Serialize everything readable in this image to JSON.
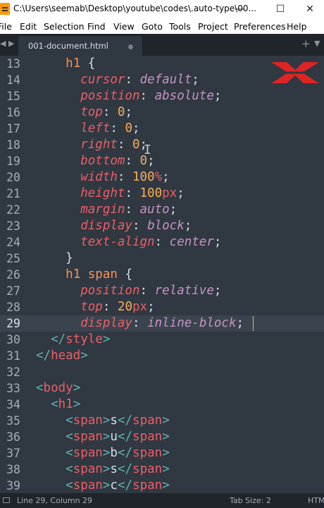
{
  "window": {
    "title": "C:\\Users\\seemab\\Desktop\\youtube\\codes\\.auto-type\\00...",
    "minimize": "—",
    "maximize": "☐",
    "close": "✕"
  },
  "menu": [
    "File",
    "Edit",
    "Selection",
    "Find",
    "View",
    "Goto",
    "Tools",
    "Project",
    "Preferences",
    "Help"
  ],
  "tabs": {
    "left_arrow": "◀",
    "right_arrow": "▶",
    "active_label": "001-document.html",
    "modified": true,
    "new_tab": "+",
    "dropdown": "▼"
  },
  "editor": {
    "first_line_number": 13,
    "active_line": 29,
    "line_numbers": [
      "13",
      "14",
      "15",
      "16",
      "17",
      "18",
      "19",
      "20",
      "21",
      "22",
      "23",
      "24",
      "25",
      "26",
      "27",
      "28",
      "29",
      "30",
      "31",
      "32",
      "33",
      "34",
      "35",
      "36",
      "37",
      "38",
      "39"
    ],
    "lines": [
      [
        [
          "    ",
          "txt"
        ],
        [
          "h1",
          "sel"
        ],
        [
          " {",
          "punc"
        ]
      ],
      [
        [
          "      ",
          "txt"
        ],
        [
          "cursor",
          "prop"
        ],
        [
          ": ",
          "punc"
        ],
        [
          "default",
          "val"
        ],
        [
          ";",
          "punc"
        ]
      ],
      [
        [
          "      ",
          "txt"
        ],
        [
          "position",
          "prop"
        ],
        [
          ": ",
          "punc"
        ],
        [
          "absolute",
          "val"
        ],
        [
          ";",
          "punc"
        ]
      ],
      [
        [
          "      ",
          "txt"
        ],
        [
          "top",
          "prop"
        ],
        [
          ": ",
          "punc"
        ],
        [
          "0",
          "num"
        ],
        [
          ";",
          "punc"
        ]
      ],
      [
        [
          "      ",
          "txt"
        ],
        [
          "left",
          "prop"
        ],
        [
          ": ",
          "punc"
        ],
        [
          "0",
          "num"
        ],
        [
          ";",
          "punc"
        ]
      ],
      [
        [
          "      ",
          "txt"
        ],
        [
          "right",
          "prop"
        ],
        [
          ": ",
          "punc"
        ],
        [
          "0",
          "num"
        ],
        [
          ";",
          "punc"
        ]
      ],
      [
        [
          "      ",
          "txt"
        ],
        [
          "bottom",
          "prop"
        ],
        [
          ": ",
          "punc"
        ],
        [
          "0",
          "num"
        ],
        [
          ";",
          "punc"
        ]
      ],
      [
        [
          "      ",
          "txt"
        ],
        [
          "width",
          "prop"
        ],
        [
          ": ",
          "punc"
        ],
        [
          "100",
          "num"
        ],
        [
          "%",
          "unit"
        ],
        [
          ";",
          "punc"
        ]
      ],
      [
        [
          "      ",
          "txt"
        ],
        [
          "height",
          "prop"
        ],
        [
          ": ",
          "punc"
        ],
        [
          "100",
          "num"
        ],
        [
          "px",
          "unit"
        ],
        [
          ";",
          "punc"
        ]
      ],
      [
        [
          "      ",
          "txt"
        ],
        [
          "margin",
          "prop"
        ],
        [
          ": ",
          "punc"
        ],
        [
          "auto",
          "val"
        ],
        [
          ";",
          "punc"
        ]
      ],
      [
        [
          "      ",
          "txt"
        ],
        [
          "display",
          "prop"
        ],
        [
          ": ",
          "punc"
        ],
        [
          "block",
          "val"
        ],
        [
          ";",
          "punc"
        ]
      ],
      [
        [
          "      ",
          "txt"
        ],
        [
          "text-align",
          "prop"
        ],
        [
          ": ",
          "punc"
        ],
        [
          "center",
          "val"
        ],
        [
          ";",
          "punc"
        ]
      ],
      [
        [
          "    }",
          "punc"
        ]
      ],
      [
        [
          "    ",
          "txt"
        ],
        [
          "h1 span",
          "sel"
        ],
        [
          " {",
          "punc"
        ]
      ],
      [
        [
          "      ",
          "txt"
        ],
        [
          "position",
          "prop"
        ],
        [
          ": ",
          "punc"
        ],
        [
          "relative",
          "val"
        ],
        [
          ";",
          "punc"
        ]
      ],
      [
        [
          "      ",
          "txt"
        ],
        [
          "top",
          "prop"
        ],
        [
          ": ",
          "punc"
        ],
        [
          "20",
          "num"
        ],
        [
          "px",
          "unit"
        ],
        [
          ";",
          "punc"
        ]
      ],
      [
        [
          "      ",
          "txt"
        ],
        [
          "display",
          "prop"
        ],
        [
          ": ",
          "punc"
        ],
        [
          "inline-block",
          "val"
        ],
        [
          ";",
          "punc"
        ]
      ],
      [
        [
          "  ",
          "txt"
        ],
        [
          "</",
          "tag"
        ],
        [
          "style",
          "tagname"
        ],
        [
          ">",
          "tag"
        ]
      ],
      [
        [
          "</",
          "tag"
        ],
        [
          "head",
          "tagname"
        ],
        [
          ">",
          "tag"
        ]
      ],
      [
        [
          "",
          "txt"
        ]
      ],
      [
        [
          "<",
          "tag"
        ],
        [
          "body",
          "tagname"
        ],
        [
          ">",
          "tag"
        ]
      ],
      [
        [
          "  ",
          "txt"
        ],
        [
          "<",
          "tag"
        ],
        [
          "h1",
          "tagname"
        ],
        [
          ">",
          "tag"
        ]
      ],
      [
        [
          "    ",
          "txt"
        ],
        [
          "<",
          "tag"
        ],
        [
          "span",
          "tagname"
        ],
        [
          ">",
          "tag"
        ],
        [
          "s",
          "txt"
        ],
        [
          "</",
          "tag"
        ],
        [
          "span",
          "tagname"
        ],
        [
          ">",
          "tag"
        ]
      ],
      [
        [
          "    ",
          "txt"
        ],
        [
          "<",
          "tag"
        ],
        [
          "span",
          "tagname"
        ],
        [
          ">",
          "tag"
        ],
        [
          "u",
          "txt"
        ],
        [
          "</",
          "tag"
        ],
        [
          "span",
          "tagname"
        ],
        [
          ">",
          "tag"
        ]
      ],
      [
        [
          "    ",
          "txt"
        ],
        [
          "<",
          "tag"
        ],
        [
          "span",
          "tagname"
        ],
        [
          ">",
          "tag"
        ],
        [
          "b",
          "txt"
        ],
        [
          "</",
          "tag"
        ],
        [
          "span",
          "tagname"
        ],
        [
          ">",
          "tag"
        ]
      ],
      [
        [
          "    ",
          "txt"
        ],
        [
          "<",
          "tag"
        ],
        [
          "span",
          "tagname"
        ],
        [
          ">",
          "tag"
        ],
        [
          "s",
          "txt"
        ],
        [
          "</",
          "tag"
        ],
        [
          "span",
          "tagname"
        ],
        [
          ">",
          "tag"
        ]
      ],
      [
        [
          "    ",
          "txt"
        ],
        [
          "<",
          "tag"
        ],
        [
          "span",
          "tagname"
        ],
        [
          ">",
          "tag"
        ],
        [
          "c",
          "txt"
        ],
        [
          "</",
          "tag"
        ],
        [
          "span",
          "tagname"
        ],
        [
          ">",
          "tag"
        ]
      ]
    ]
  },
  "status": {
    "position": "Line 29, Column 29",
    "tab_size": "Tab Size: 2",
    "syntax": "HTML"
  },
  "colors": {
    "editor_bg": "#303841",
    "chrome_bg": "#1f252a",
    "selector": "#f99157",
    "property": "#ec5f67",
    "value": "#c594c5",
    "number": "#f9ae58",
    "tag": "#5fb3b3",
    "logo_red": "#e02424"
  },
  "icons": {
    "app": "sublime-text-icon",
    "logo": "x-logo-icon",
    "status": "panel-toggle-icon"
  }
}
